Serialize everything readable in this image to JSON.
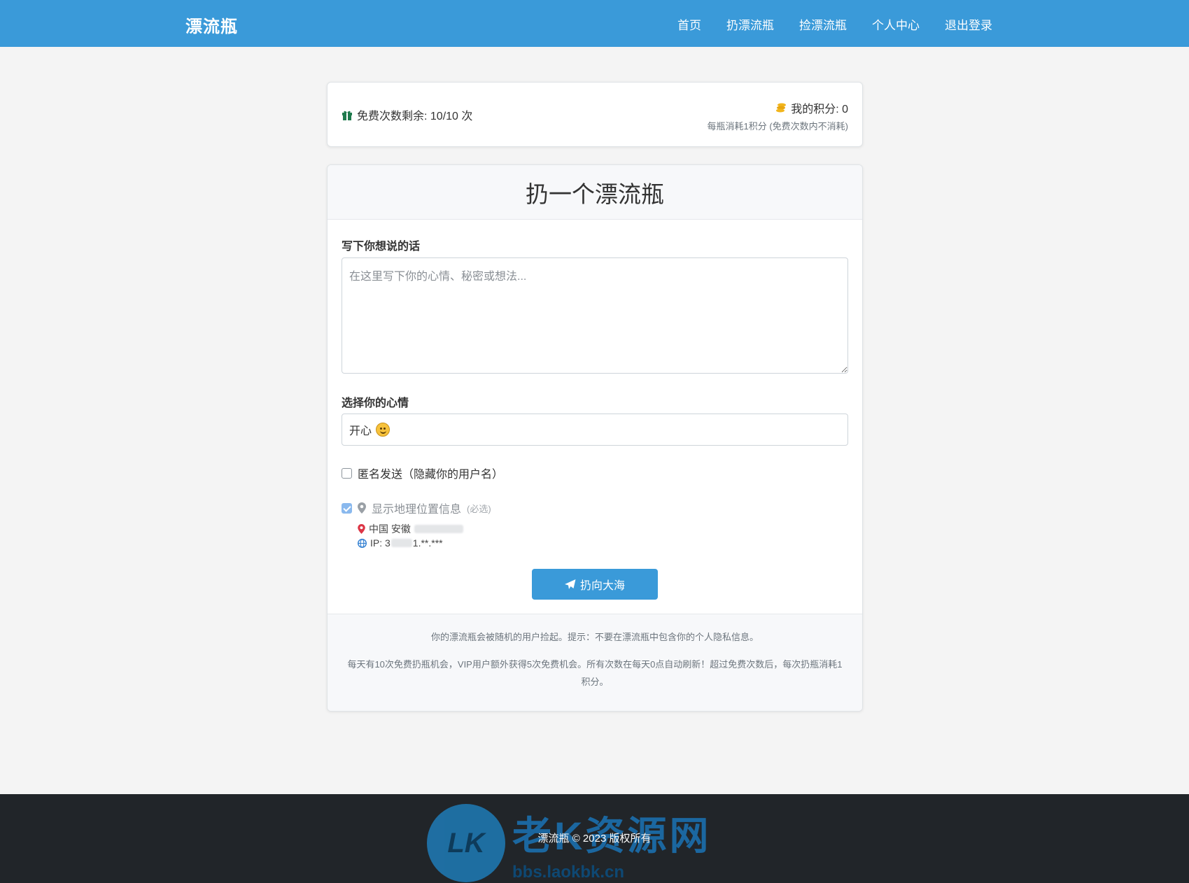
{
  "nav": {
    "brand": "漂流瓶",
    "links": [
      "首页",
      "扔漂流瓶",
      "捡漂流瓶",
      "个人中心",
      "退出登录"
    ]
  },
  "stats": {
    "free_remaining": "免费次数剩余: 10/10 次",
    "points": "我的积分: 0",
    "points_note": "每瓶消耗1积分 (免费次数内不消耗)"
  },
  "form": {
    "title": "扔一个漂流瓶",
    "message_label": "写下你想说的话",
    "message_placeholder": "在这里写下你的心情、秘密或想法...",
    "mood_label": "选择你的心情",
    "mood_value": "开心",
    "anonymous_label": "匿名发送（隐藏你的用户名）",
    "anonymous_checked": false,
    "location_label": "显示地理位置信息",
    "location_required": "(必选)",
    "location_checked": true,
    "location_city": "中国 安徽",
    "ip_prefix": "IP: 3",
    "ip_suffix": "1.**.***",
    "submit_label": "扔向大海"
  },
  "notes": {
    "note1": "你的漂流瓶会被随机的用户捡起。提示：不要在漂流瓶中包含你的个人隐私信息。",
    "note2": "每天有10次免费扔瓶机会，VIP用户额外获得5次免费机会。所有次数在每天0点自动刷新！超过免费次数后，每次扔瓶消耗1积分。"
  },
  "footer": {
    "copyright": "漂流瓶 © 2023 版权所有"
  },
  "watermark": {
    "logo_text": "LK",
    "title": "老K资源网",
    "url": "bbs.laokbk.cn"
  },
  "colors": {
    "primary": "#3a9ad9",
    "footer_bg": "#212529",
    "page_bg": "#f4f4f4"
  }
}
